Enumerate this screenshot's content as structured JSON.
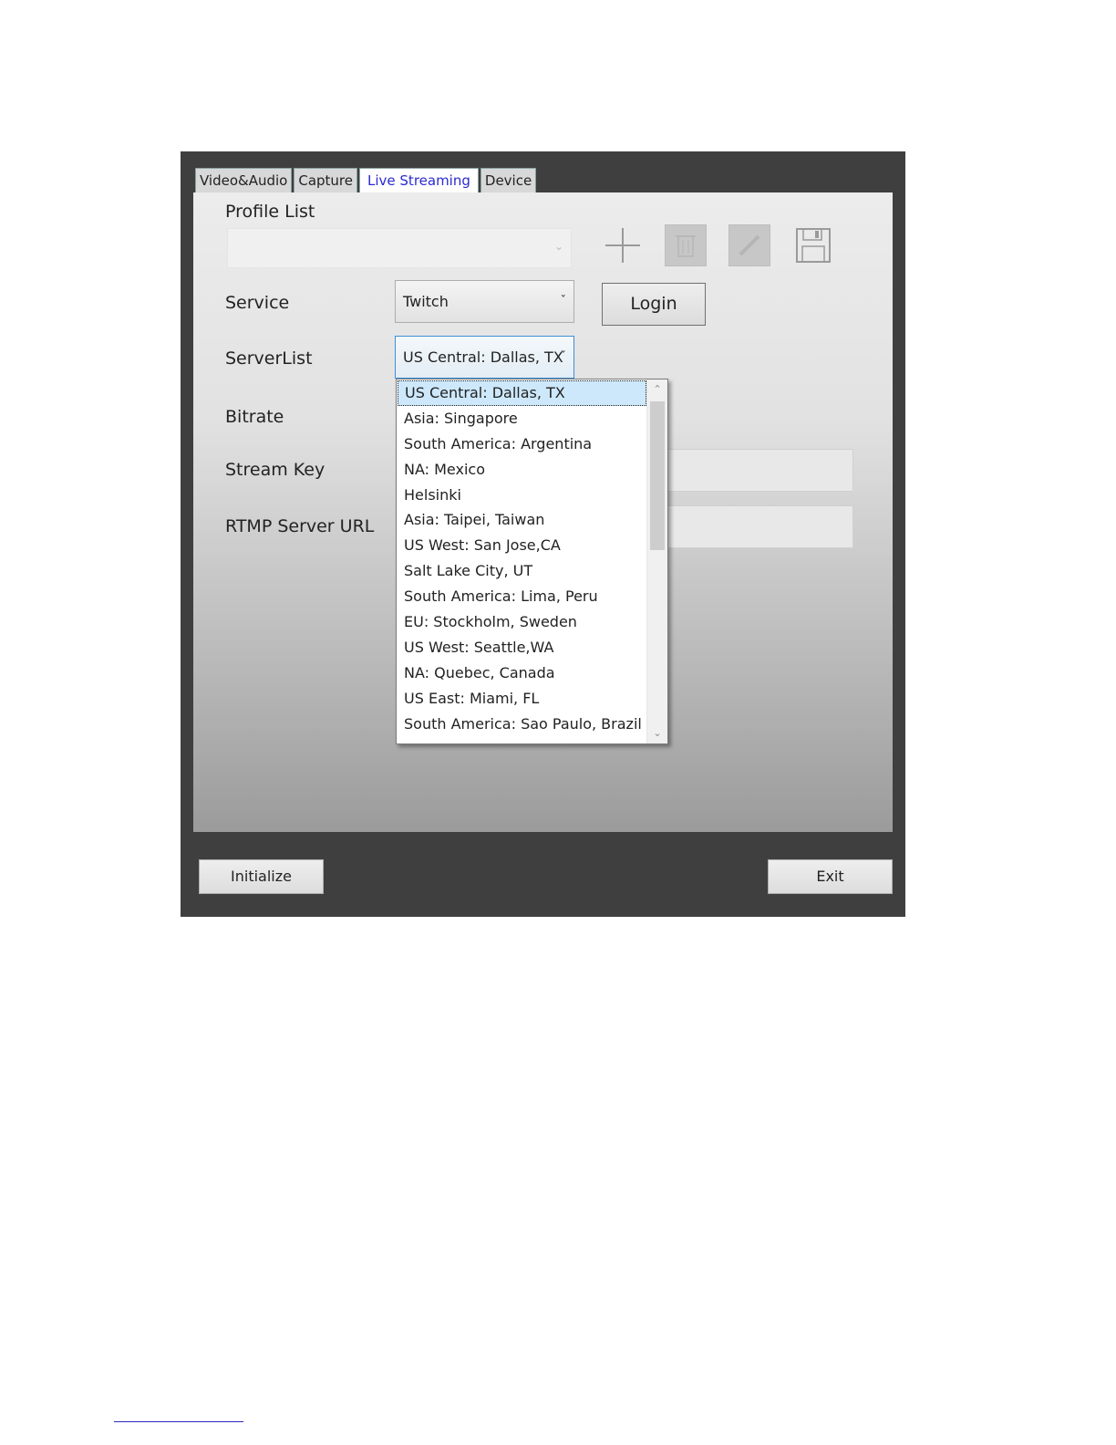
{
  "tabs": [
    "Video&Audio",
    "Capture",
    "Live Streaming",
    "Device"
  ],
  "active_tab": "Live Streaming",
  "labels": {
    "profile_list": "Profile List",
    "service": "Service",
    "server_list": "ServerList",
    "bitrate": "Bitrate",
    "stream_key": "Stream Key",
    "rtmp_server_url": "RTMP Server URL"
  },
  "profile_list": {
    "value": ""
  },
  "toolbar_icons": [
    "add-icon",
    "delete-icon",
    "edit-icon",
    "save-icon"
  ],
  "service": {
    "value": "Twitch"
  },
  "login_label": "Login",
  "server_list": {
    "value": "US Central: Dallas, TX",
    "options": [
      "US Central: Dallas, TX",
      "Asia: Singapore",
      "South America: Argentina",
      "NA: Mexico",
      "Helsinki",
      "Asia: Taipei, Taiwan",
      "US West: San Jose,CA",
      "Salt Lake City, UT",
      "South America: Lima, Peru",
      "EU: Stockholm, Sweden",
      "US West: Seattle,WA",
      "NA: Quebec, Canada",
      "US East: Miami, FL",
      "South America: Sao Paulo, Brazil"
    ],
    "selected_index": 0
  },
  "buttons": {
    "initialize": "Initialize",
    "exit": "Exit"
  },
  "colors": {
    "frame": "#3f3f3f",
    "active_tab_text": "#2a2ad0",
    "focus_border": "#3f8fd2",
    "selection": "#cde8fb"
  }
}
